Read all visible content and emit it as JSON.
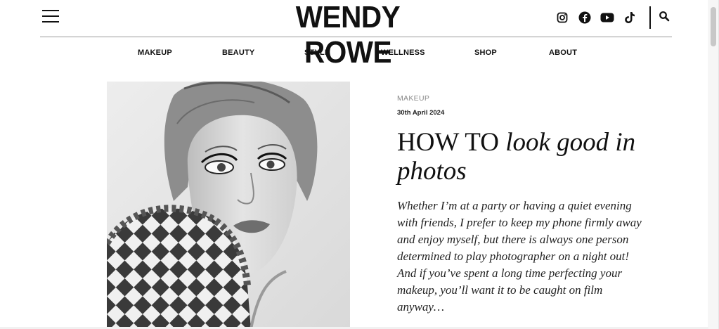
{
  "header": {
    "logo": "WENDY ROWE",
    "social": [
      {
        "name": "instagram-icon"
      },
      {
        "name": "facebook-icon"
      },
      {
        "name": "youtube-icon"
      },
      {
        "name": "tiktok-icon"
      }
    ],
    "search_icon": "search-icon",
    "menu_icon": "hamburger-menu-icon"
  },
  "nav": {
    "items": [
      "MAKEUP",
      "BEAUTY",
      "STYLE",
      "WELLNESS",
      "SHOP",
      "ABOUT"
    ]
  },
  "article": {
    "category": "MAKEUP",
    "date": "30th April 2024",
    "title_plain": "HOW TO",
    "title_italic": "look good in photos",
    "excerpt": "Whether I’m at a party or having a quiet evening with friends, I prefer to keep my phone firmly away and enjoy myself, but there is always one person determined to play photographer on a night out! And if you’ve spent a long time perfecting your makeup, you’ll want it to be caught on film anyway…"
  },
  "colors": {
    "text": "#111111",
    "muted": "#888888",
    "rule": "#9a9a9a"
  }
}
